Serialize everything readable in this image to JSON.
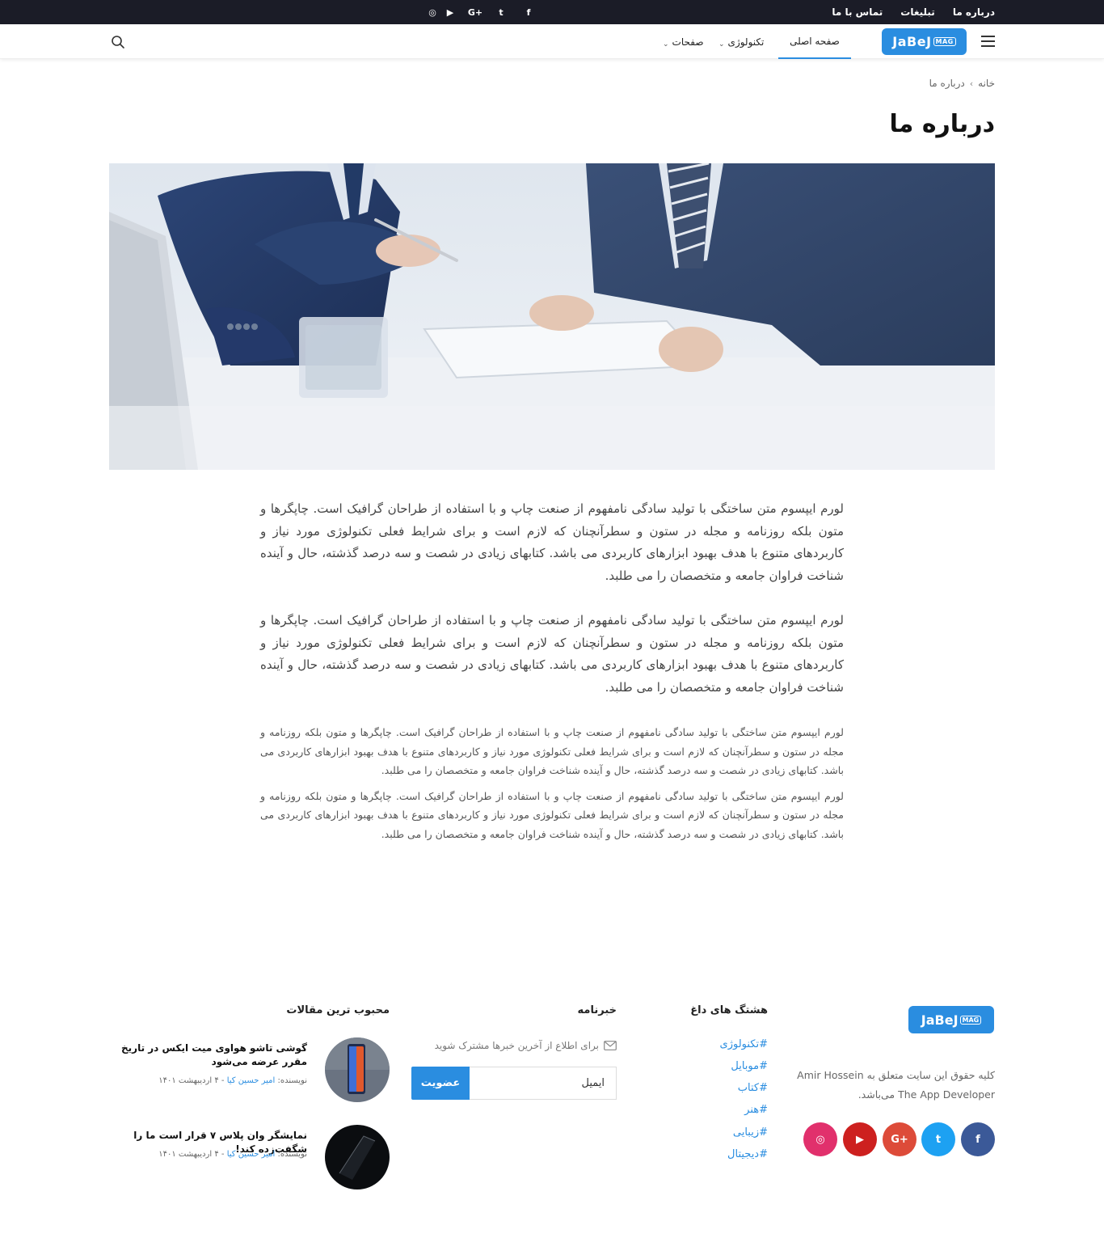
{
  "topbar": {
    "links": [
      "درباره ما",
      "تبلیغات",
      "تماس با ما"
    ],
    "social_icons": [
      "instagram-icon",
      "youtube-icon",
      "google-plus-icon",
      "twitter-icon",
      "facebook-icon"
    ],
    "social_glyphs": [
      "◎",
      "▶",
      "G+",
      "t",
      "f"
    ]
  },
  "header": {
    "logo_text": "JaBeJ",
    "logo_sub": "MAG",
    "nav": [
      {
        "label": "صفحه اصلی",
        "active": true
      },
      {
        "label": "تکنولوژی",
        "dropdown": true
      },
      {
        "label": "صفحات",
        "dropdown": true
      }
    ]
  },
  "breadcrumb": {
    "home": "خانه",
    "current": "درباره ما"
  },
  "page": {
    "title": "درباره ما",
    "paragraphs_large": [
      "لورم ایپسوم متن ساختگی با تولید سادگی نامفهوم از صنعت چاپ و با استفاده از طراحان گرافیک است. چاپگرها و متون بلکه روزنامه و مجله در ستون و سطرآنچنان که لازم است و برای شرایط فعلی تکنولوژی مورد نیاز و کاربردهای متنوع با هدف بهبود ابزارهای کاربردی می باشد. کتابهای زیادی در شصت و سه درصد گذشته، حال و آینده شناخت فراوان جامعه و متخصصان را می طلبد.",
      "لورم ایپسوم متن ساختگی با تولید سادگی نامفهوم از صنعت چاپ و با استفاده از طراحان گرافیک است. چاپگرها و متون بلکه روزنامه و مجله در ستون و سطرآنچنان که لازم است و برای شرایط فعلی تکنولوژی مورد نیاز و کاربردهای متنوع با هدف بهبود ابزارهای کاربردی می باشد. کتابهای زیادی در شصت و سه درصد گذشته، حال و آینده شناخت فراوان جامعه و متخصصان را می طلبد."
    ],
    "paragraphs_small": [
      "لورم ایپسوم متن ساختگی با تولید سادگی نامفهوم از صنعت چاپ و با استفاده از طراحان گرافیک است. چاپگرها و متون بلکه روزنامه و مجله در ستون و سطرآنچنان که لازم است و برای شرایط فعلی تکنولوژی مورد نیاز و کاربردهای متنوع با هدف بهبود ابزارهای کاربردی می باشد. کتابهای زیادی در شصت و سه درصد گذشته، حال و آینده شناخت فراوان جامعه و متخصصان را می طلبد.",
      "لورم ایپسوم متن ساختگی با تولید سادگی نامفهوم از صنعت چاپ و با استفاده از طراحان گرافیک است. چاپگرها و متون بلکه روزنامه و مجله در ستون و سطرآنچنان که لازم است و برای شرایط فعلی تکنولوژی مورد نیاز و کاربردهای متنوع با هدف بهبود ابزارهای کاربردی می باشد. کتابهای زیادی در شصت و سه درصد گذشته، حال و آینده شناخت فراوان جامعه و متخصصان را می طلبد."
    ]
  },
  "footer": {
    "logo_text": "JaBeJ",
    "logo_sub": "MAG",
    "copyright": "کلیه حقوق این سایت متعلق به Amir Hossein The App Developer می‌باشد.",
    "social": [
      {
        "name": "facebook-icon",
        "glyph": "f",
        "color": "#3b5998"
      },
      {
        "name": "twitter-icon",
        "glyph": "t",
        "color": "#1da1f2"
      },
      {
        "name": "google-plus-icon",
        "glyph": "G+",
        "color": "#dd4b39"
      },
      {
        "name": "youtube-icon",
        "glyph": "▶",
        "color": "#cd201f"
      },
      {
        "name": "instagram-icon",
        "glyph": "◎",
        "color": "#e1306c"
      }
    ],
    "hashtags_title": "هشتگ های داغ",
    "hashtags": [
      "#تکنولوژی",
      "#موبایل",
      "#کتاب",
      "#هنر",
      "#زیبایی",
      "#دیجیتال"
    ],
    "newsletter_title": "خبرنامه",
    "newsletter_text": "برای اطلاع از آخرین خبرها مشترک شوید",
    "newsletter_placeholder": "ایمیل",
    "newsletter_button": "عضویت",
    "popular_title": "محبوب ترین مقالات",
    "posts": [
      {
        "title": "گوشی تاشو هواوی میت ایکس در تاریخ مقرر عرضه می‌شود",
        "author_label": "نویسنده:",
        "author": "امیر حسین کیا",
        "date": "۴ اردیبهشت ۱۴۰۱"
      },
      {
        "title": "نمایشگر وان پلاس ۷ قرار است ما را شگفت‌زده کند!",
        "author_label": "نویسنده:",
        "author": "امیر حسین کیا",
        "date": "۴ اردیبهشت ۱۴۰۱"
      }
    ]
  },
  "colors": {
    "accent": "#2a8de0",
    "topbar": "#1b1c27"
  }
}
